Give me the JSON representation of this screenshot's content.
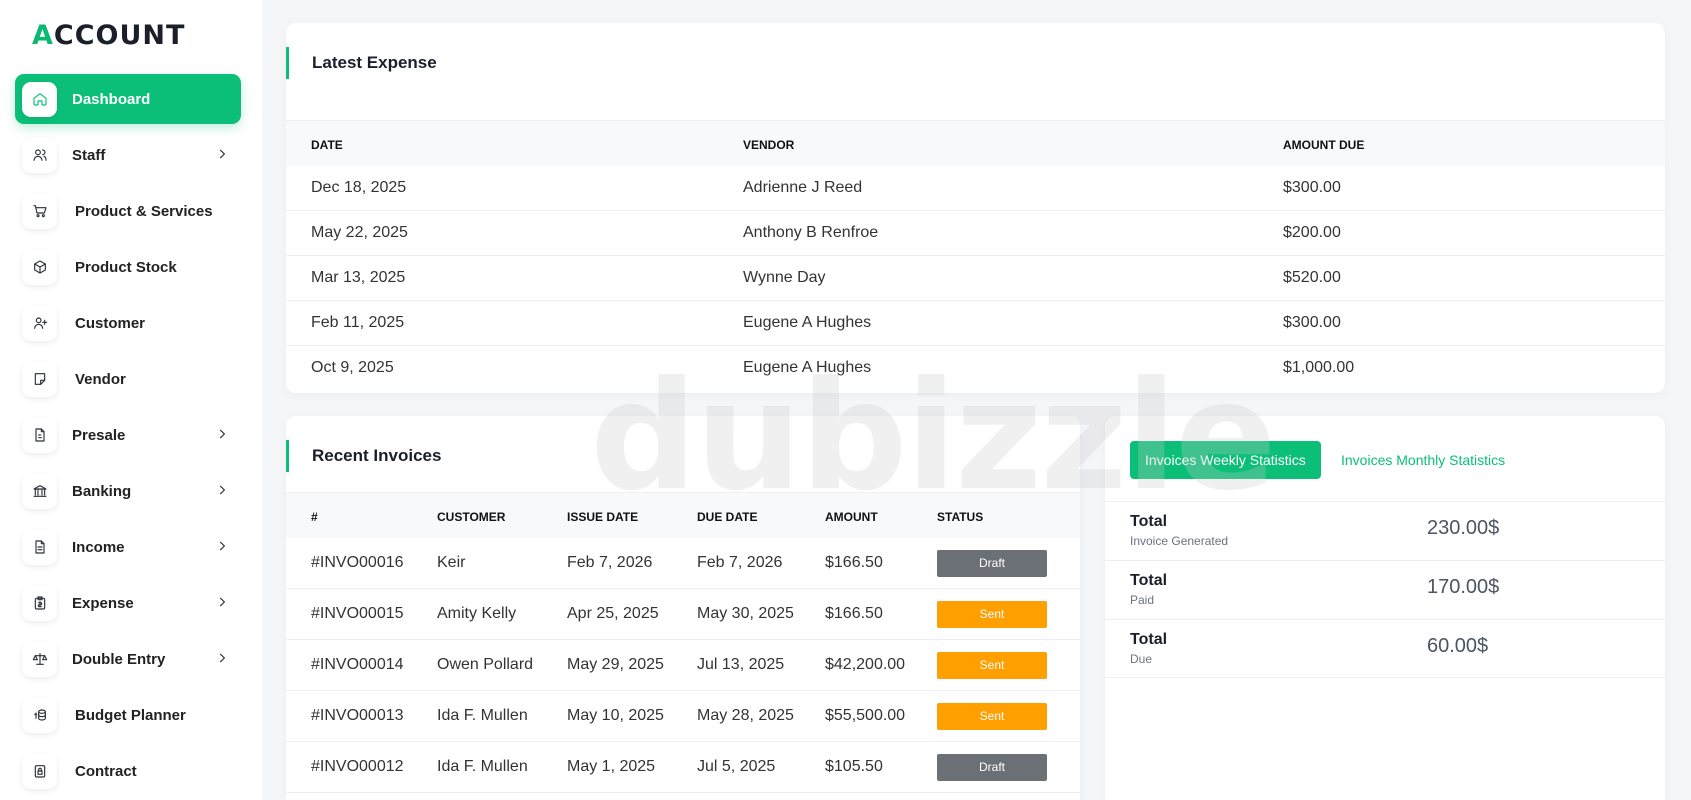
{
  "logo": {
    "prefix": "A",
    "rest": "CCOUNT"
  },
  "sidebar": {
    "items": [
      {
        "label": "Dashboard"
      },
      {
        "label": "Staff"
      },
      {
        "label": "Product & Services"
      },
      {
        "label": "Product Stock"
      },
      {
        "label": "Customer"
      },
      {
        "label": "Vendor"
      },
      {
        "label": "Presale"
      },
      {
        "label": "Banking"
      },
      {
        "label": "Income"
      },
      {
        "label": "Expense"
      },
      {
        "label": "Double Entry"
      },
      {
        "label": "Budget Planner"
      },
      {
        "label": "Contract"
      }
    ]
  },
  "expense": {
    "title": "Latest Expense",
    "headers": [
      "DATE",
      "VENDOR",
      "AMOUNT DUE"
    ],
    "rows": [
      [
        "Dec 18, 2025",
        "Adrienne J Reed",
        "$300.00"
      ],
      [
        "May 22, 2025",
        "Anthony B Renfroe",
        "$200.00"
      ],
      [
        "Mar 13, 2025",
        "Wynne Day",
        "$520.00"
      ],
      [
        "Feb 11, 2025",
        "Eugene A Hughes",
        "$300.00"
      ],
      [
        "Oct 9, 2025",
        "Eugene A Hughes",
        "$1,000.00"
      ]
    ]
  },
  "invoices": {
    "title": "Recent Invoices",
    "headers": [
      "#",
      "CUSTOMER",
      "ISSUE DATE",
      "DUE DATE",
      "AMOUNT",
      "STATUS"
    ],
    "rows": [
      [
        "#INVO00016",
        "Keir",
        "Feb 7, 2026",
        "Feb 7, 2026",
        "$166.50",
        "Draft"
      ],
      [
        "#INVO00015",
        "Amity Kelly",
        "Apr 25, 2025",
        "May 30, 2025",
        "$166.50",
        "Sent"
      ],
      [
        "#INVO00014",
        "Owen Pollard",
        "May 29, 2025",
        "Jul 13, 2025",
        "$42,200.00",
        "Sent"
      ],
      [
        "#INVO00013",
        "Ida F. Mullen",
        "May 10, 2025",
        "May 28, 2025",
        "$55,500.00",
        "Sent"
      ],
      [
        "#INVO00012",
        "Ida F. Mullen",
        "May 1, 2025",
        "Jul 5, 2025",
        "$105.50",
        "Draft"
      ]
    ]
  },
  "stats": {
    "tab_weekly": "Invoices Weekly Statistics",
    "tab_monthly": "Invoices Monthly Statistics",
    "rows": [
      {
        "label": "Total",
        "sub": "Invoice Generated",
        "value": "230.00$"
      },
      {
        "label": "Total",
        "sub": "Paid",
        "value": "170.00$"
      },
      {
        "label": "Total",
        "sub": "Due",
        "value": "60.00$"
      }
    ]
  },
  "watermark": "dubizzle",
  "colors": {
    "accent": "#0bbf78",
    "draft": "#6b7076",
    "sent": "#ff9f00"
  }
}
